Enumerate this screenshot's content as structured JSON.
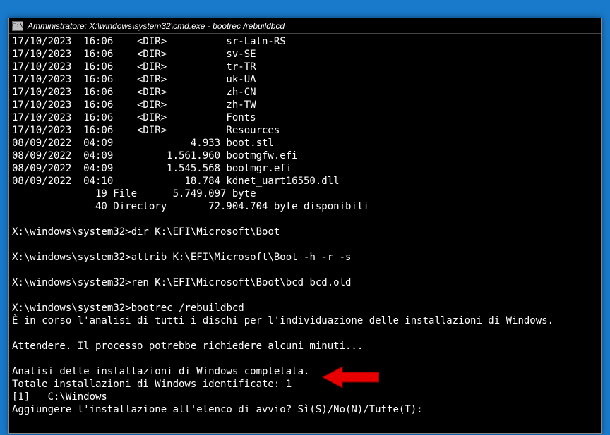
{
  "window": {
    "title": "Amministratore: X:\\windows\\system32\\cmd.exe - bootrec /rebuildbcd"
  },
  "dir_entries": [
    {
      "date": "17/10/2023",
      "time": "16:06",
      "type": "<DIR>",
      "size": "",
      "name": "sr-Latn-RS"
    },
    {
      "date": "17/10/2023",
      "time": "16:06",
      "type": "<DIR>",
      "size": "",
      "name": "sv-SE"
    },
    {
      "date": "17/10/2023",
      "time": "16:06",
      "type": "<DIR>",
      "size": "",
      "name": "tr-TR"
    },
    {
      "date": "17/10/2023",
      "time": "16:06",
      "type": "<DIR>",
      "size": "",
      "name": "uk-UA"
    },
    {
      "date": "17/10/2023",
      "time": "16:06",
      "type": "<DIR>",
      "size": "",
      "name": "zh-CN"
    },
    {
      "date": "17/10/2023",
      "time": "16:06",
      "type": "<DIR>",
      "size": "",
      "name": "zh-TW"
    },
    {
      "date": "17/10/2023",
      "time": "16:06",
      "type": "<DIR>",
      "size": "",
      "name": "Fonts"
    },
    {
      "date": "17/10/2023",
      "time": "16:06",
      "type": "<DIR>",
      "size": "",
      "name": "Resources"
    },
    {
      "date": "08/09/2022",
      "time": "04:09",
      "type": "",
      "size": "4.933",
      "name": "boot.stl"
    },
    {
      "date": "08/09/2022",
      "time": "04:09",
      "type": "",
      "size": "1.561.960",
      "name": "bootmgfw.efi"
    },
    {
      "date": "08/09/2022",
      "time": "04:09",
      "type": "",
      "size": "1.545.568",
      "name": "bootmgr.efi"
    },
    {
      "date": "08/09/2022",
      "time": "04:10",
      "type": "",
      "size": "18.784",
      "name": "kdnet_uart16550.dll"
    }
  ],
  "summary": {
    "files_line": "              19 File      5.749.097 byte",
    "dirs_line": "              40 Directory       72.904.704 byte disponibili"
  },
  "prompt_path": "X:\\windows\\system32>",
  "cmd1": "dir K:\\EFI\\Microsoft\\Boot",
  "cmd2": "attrib K:\\EFI\\Microsoft\\Boot -h -r -s",
  "cmd3": "ren K:\\EFI\\Microsoft\\Boot\\bcd bcd.old",
  "cmd4": "bootrec /rebuildbcd",
  "msg_scan": "È in corso l'analisi di tutti i dischi per l'individuazione delle installazioni di Windows.",
  "msg_wait": "Attendere. Il processo potrebbe richiedere alcuni minuti...",
  "msg_done": "Analisi delle installazioni di Windows completata.",
  "msg_total": "Totale installazioni di Windows identificate: 1",
  "msg_inst": "[1]   C:\\Windows",
  "msg_prompt": "Aggiungere l'installazione all'elenco di avvio? Sì(S)/No(N)/Tutte(T):"
}
